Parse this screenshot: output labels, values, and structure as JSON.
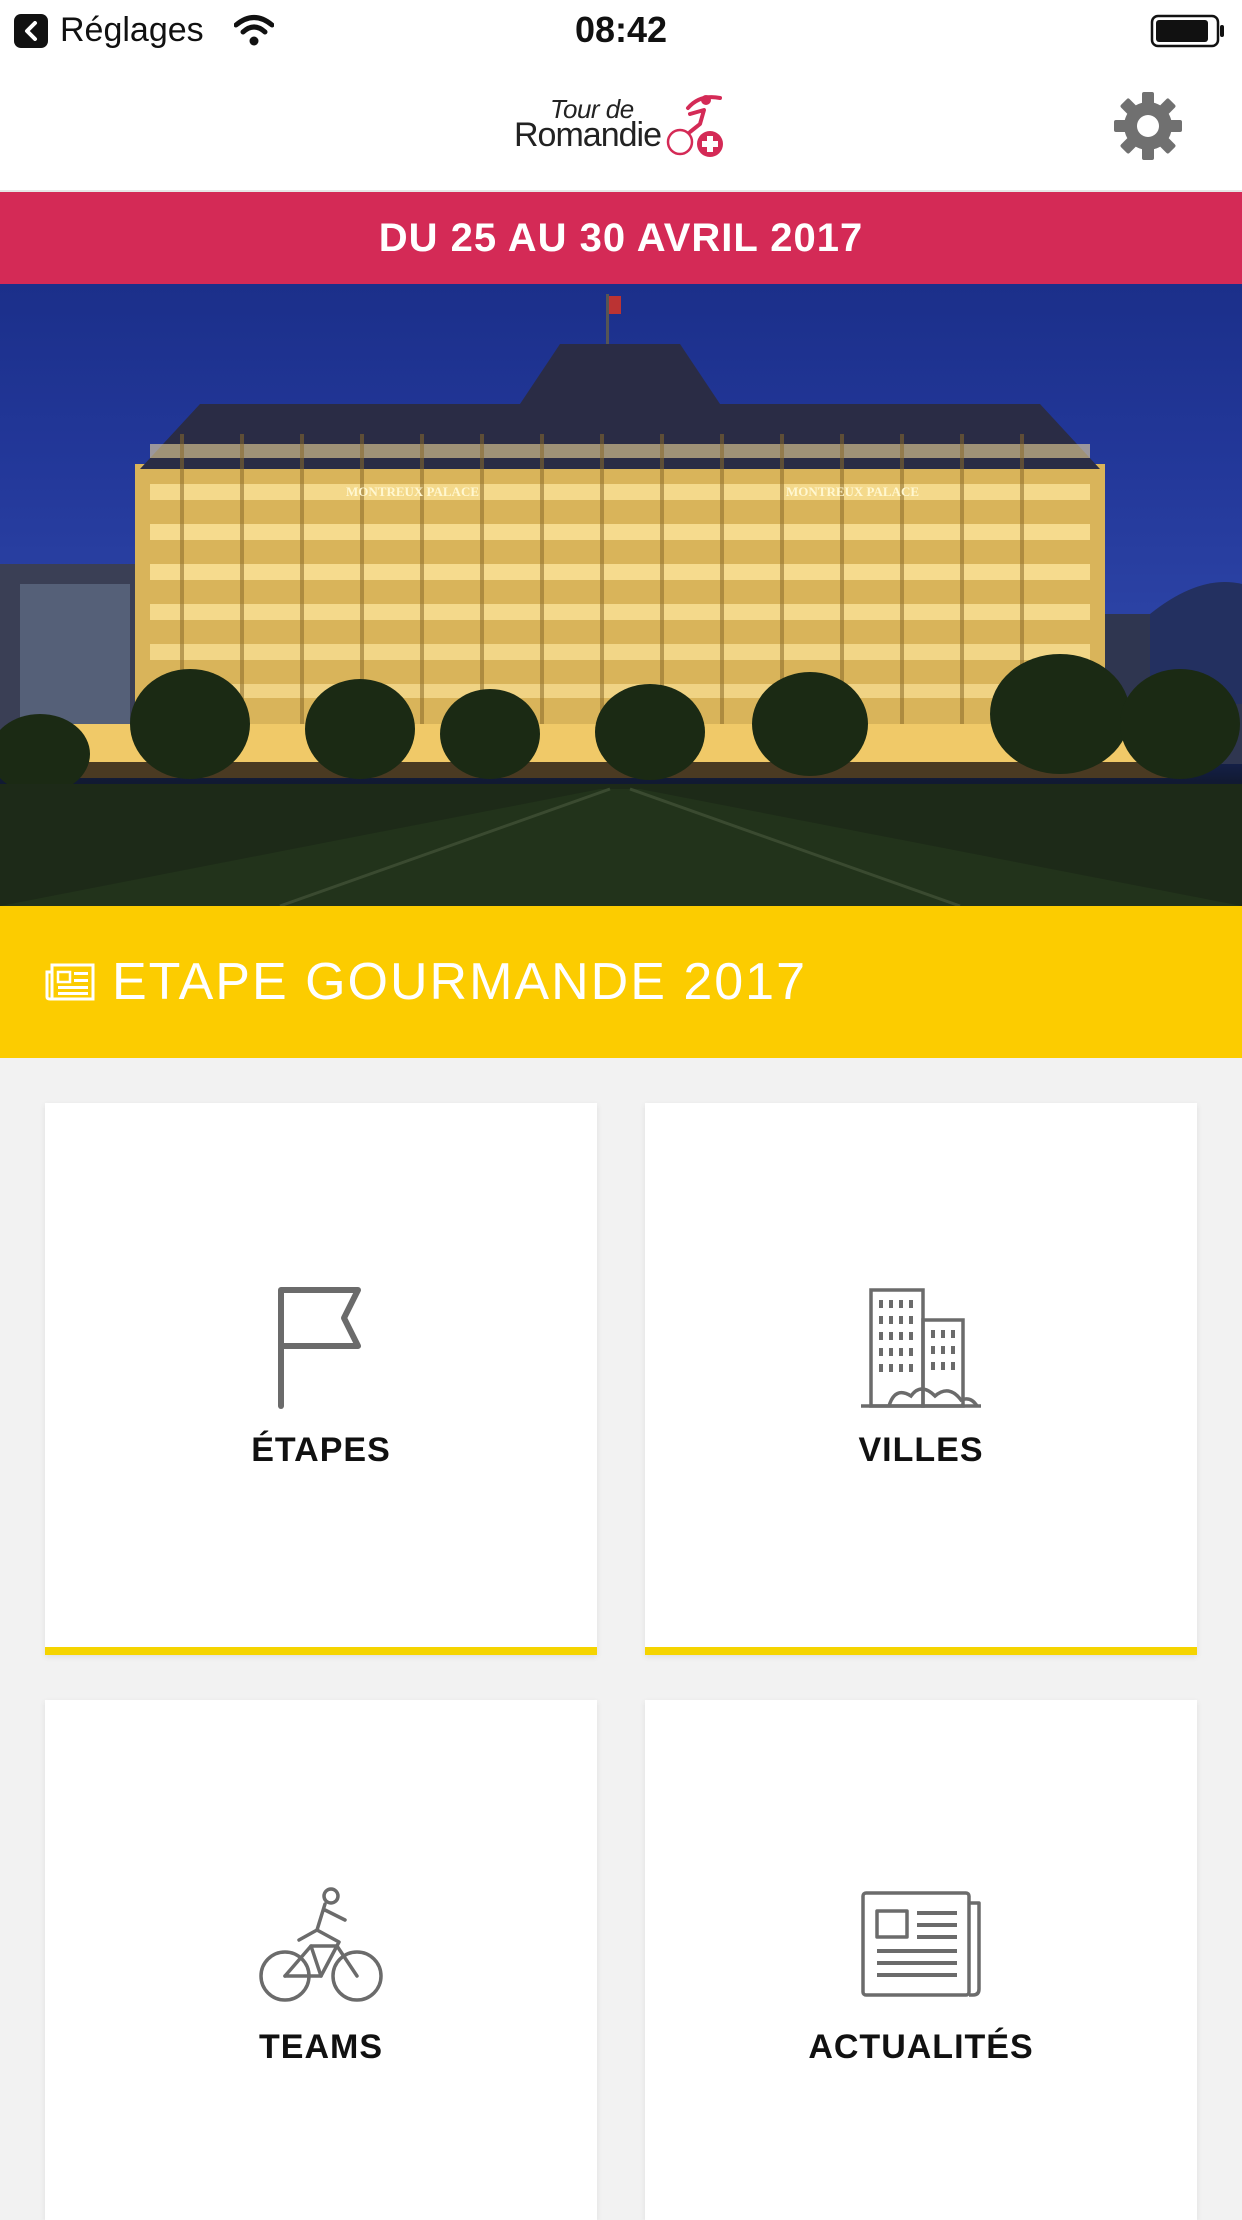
{
  "status_bar": {
    "back_label": "Réglages",
    "time": "08:42"
  },
  "header": {
    "logo_line1": "Tour de",
    "logo_line2": "Romandie",
    "settings_icon": "gear-icon"
  },
  "date_banner": {
    "text": "DU 25 AU 30 AVRIL 2017"
  },
  "hero": {
    "sign_left": "MONTREUX PALACE",
    "sign_right": "MONTREUX PALACE"
  },
  "featured": {
    "icon": "newspaper-icon",
    "title": "ETAPE GOURMANDE 2017"
  },
  "tiles": [
    {
      "label": "ÉTAPES",
      "icon": "flag-icon"
    },
    {
      "label": "VILLES",
      "icon": "buildings-icon"
    },
    {
      "label": "TEAMS",
      "icon": "cyclist-icon"
    },
    {
      "label": "ACTUALITÉS",
      "icon": "newspaper-icon"
    }
  ],
  "colors": {
    "date_banner": "#d42a56",
    "featured_banner": "#fccc00",
    "tile_accent": "#f5d400",
    "icon_gray": "#6b6b6b"
  }
}
